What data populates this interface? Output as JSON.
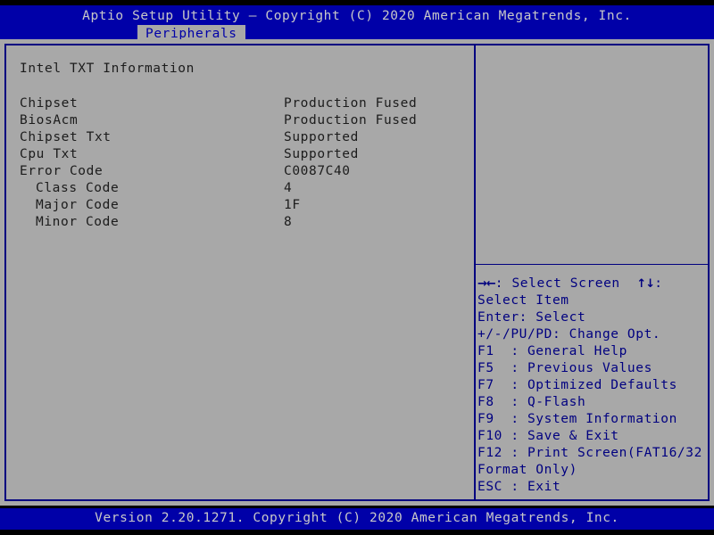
{
  "header": {
    "title": "Aptio Setup Utility – Copyright (C) 2020 American Megatrends, Inc.",
    "active_tab": "Peripherals"
  },
  "main": {
    "section_title": "Intel TXT Information",
    "rows": [
      {
        "label": "Chipset",
        "value": "Production Fused",
        "indent": false
      },
      {
        "label": "BiosAcm",
        "value": "Production Fused",
        "indent": false
      },
      {
        "label": "Chipset Txt",
        "value": "Supported",
        "indent": false
      },
      {
        "label": "Cpu Txt",
        "value": "Supported",
        "indent": false
      },
      {
        "label": "Error Code",
        "value": "C0087C40",
        "indent": false
      },
      {
        "label": "Class Code",
        "value": "4",
        "indent": true
      },
      {
        "label": "Major Code",
        "value": "1F",
        "indent": true
      },
      {
        "label": "Minor Code",
        "value": "8",
        "indent": true
      }
    ]
  },
  "help": {
    "lines": [
      "→←: Select Screen  ↑↓: Select Item",
      "Enter: Select",
      "+/-/PU/PD: Change Opt.",
      "F1  : General Help",
      "F5  : Previous Values",
      "F7  : Optimized Defaults",
      "F8  : Q-Flash",
      "F9  : System Information",
      "F10 : Save & Exit",
      "F12 : Print Screen(FAT16/32 Format Only)",
      "ESC : Exit"
    ]
  },
  "footer": {
    "text": "Version 2.20.1271. Copyright (C) 2020 American Megatrends, Inc."
  },
  "colors": {
    "header_blue": "#0000a8",
    "panel_gray": "#a8a8a8",
    "border_blue": "#000080",
    "help_text": "#000080",
    "main_text": "#1c1c1c",
    "header_text": "#c8c8c8"
  }
}
